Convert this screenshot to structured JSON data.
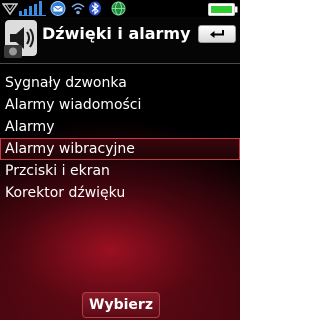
{
  "status_bar": {
    "icons": [
      "network-type-icon",
      "signal-strength-icon",
      "message-icon",
      "wifi-icon",
      "bluetooth-icon",
      "globe-icon",
      "battery-icon"
    ]
  },
  "header": {
    "title": "Dźwięki i alarmy",
    "icon": "sounds-alerts-icon",
    "back_icon": "back-arrow-icon"
  },
  "menu": {
    "items": [
      {
        "label": "Sygnały dzwonka",
        "selected": false
      },
      {
        "label": "Alarmy wiadomości",
        "selected": false
      },
      {
        "label": "Alarmy",
        "selected": false
      },
      {
        "label": "Alarmy wibracyjne",
        "selected": true
      },
      {
        "label": "Przciski i ekran",
        "selected": false
      },
      {
        "label": "Korektor dźwięku",
        "selected": false
      }
    ]
  },
  "softkey": {
    "label": "Wybierz"
  },
  "colors": {
    "accent": "#b01226",
    "selection_border": "#c43a48",
    "battery": "#33cc33"
  }
}
